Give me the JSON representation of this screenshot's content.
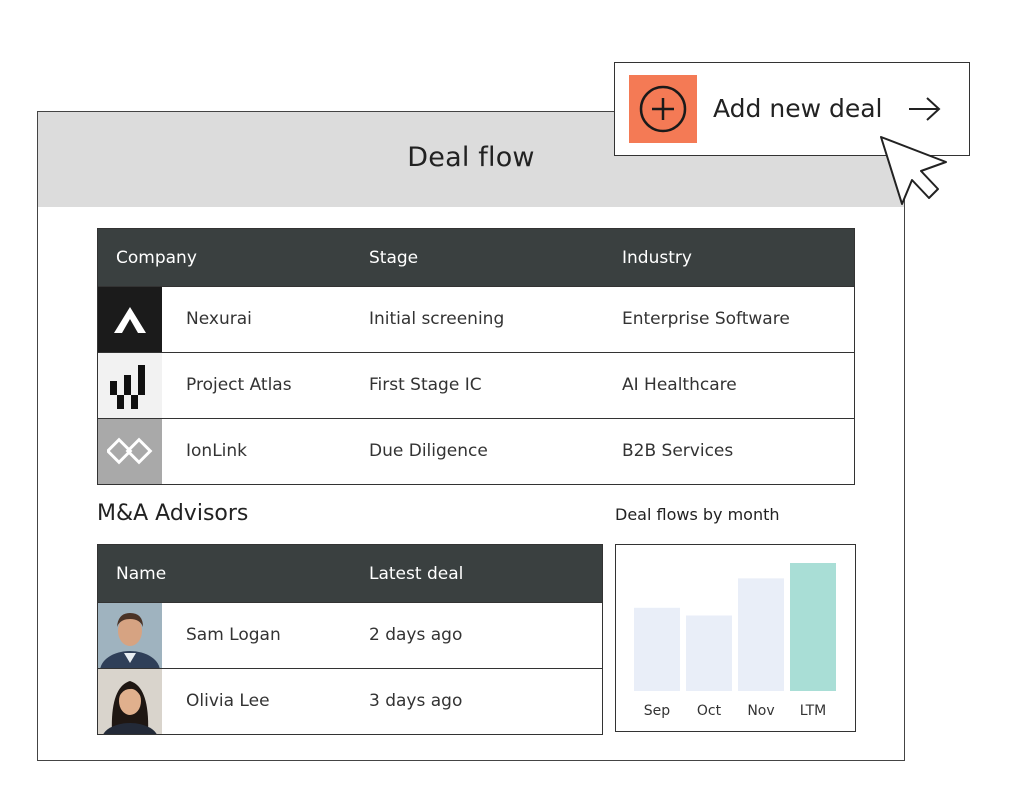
{
  "panel": {
    "title": "Deal flow"
  },
  "add_button": {
    "label": "Add new deal"
  },
  "deals": {
    "columns": [
      "Company",
      "Stage",
      "Industry"
    ],
    "rows": [
      {
        "company": "Nexurai",
        "stage": "Initial screening",
        "industry": "Enterprise Software",
        "logo": "nexurai-logo"
      },
      {
        "company": "Project Atlas",
        "stage": "First Stage IC",
        "industry": "AI Healthcare",
        "logo": "atlas-logo"
      },
      {
        "company": "IonLink",
        "stage": "Due Diligence",
        "industry": "B2B Services",
        "logo": "ionlink-logo"
      }
    ]
  },
  "advisors": {
    "title": "M&A Advisors",
    "columns": [
      "Name",
      "Latest deal"
    ],
    "rows": [
      {
        "name": "Sam Logan",
        "latest": "2 days ago"
      },
      {
        "name": "Olivia Lee",
        "latest": "3 days ago"
      }
    ]
  },
  "chart_data": {
    "type": "bar",
    "title": "Deal flows by month",
    "categories": [
      "Sep",
      "Oct",
      "Nov",
      "LTM"
    ],
    "values": [
      0.65,
      0.59,
      0.88,
      1.0
    ],
    "colors": [
      "#e9eef8",
      "#e9eef8",
      "#e9eef8",
      "#a9ded6"
    ],
    "grid": false
  }
}
